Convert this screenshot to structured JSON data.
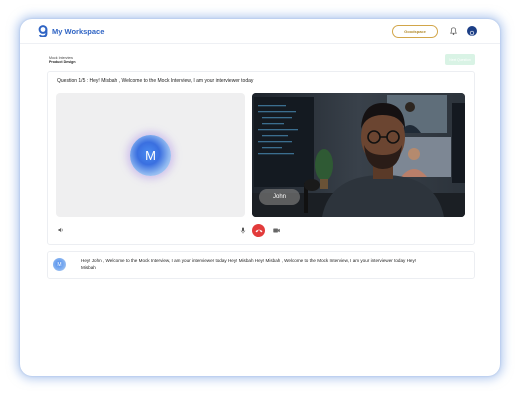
{
  "header": {
    "brand": "My Workspace",
    "goodspace_label": "Goodspace"
  },
  "breadcrumb": {
    "line1": "Mock Interview",
    "line2": "Product Design"
  },
  "next_button_label": "Next Question",
  "interview": {
    "question": "Question 1/5 : Hey! Misbah , Welcome to the Mock Interview, I am your interviewer today",
    "ai_initial": "M",
    "participant_name": "John"
  },
  "chat": {
    "avatar_initial": "M",
    "message": "Hey! John , Welcome to the Mock Interview, I am your interviewer today Hey! Misbah Hey! Misbah , Welcome to the Mock Interview, I am your interviewer today Hey! Misbah"
  },
  "icons": {
    "logo": "goodspace-logo-icon",
    "bell": "bell-icon",
    "profile": "user-avatar-icon",
    "speaker": "speaker-icon",
    "mic": "microphone-icon",
    "end_call": "end-call-icon",
    "camera": "video-camera-icon"
  },
  "colors": {
    "brand": "#2f64c4",
    "accent_gold": "#d2a64a",
    "end_call": "#e23b3b",
    "next_button_bg": "#d9f3e5"
  }
}
